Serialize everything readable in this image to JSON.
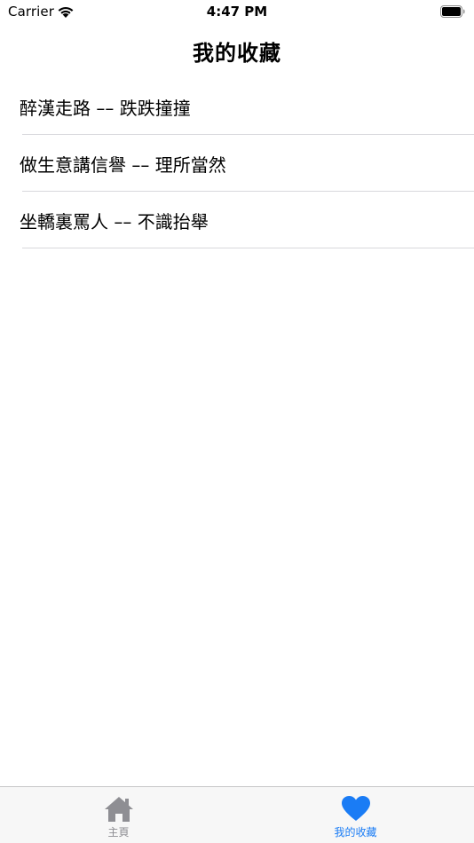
{
  "status_bar": {
    "carrier": "Carrier",
    "time": "4:47 PM",
    "wifi_icon": "wifi-icon",
    "battery_icon": "battery-icon"
  },
  "nav": {
    "title": "我的收藏"
  },
  "favorites": [
    {
      "label": "醉漢走路 –– 跌跌撞撞"
    },
    {
      "label": "做生意講信譽 –– 理所當然"
    },
    {
      "label": "坐轎裏罵人 –– 不識抬舉"
    }
  ],
  "tab_bar": {
    "tabs": [
      {
        "label": "主頁",
        "icon": "home-icon",
        "active": false
      },
      {
        "label": "我的收藏",
        "icon": "heart-icon",
        "active": true
      }
    ],
    "colors": {
      "active": "#1a7cf5",
      "inactive": "#8e8e93"
    }
  }
}
